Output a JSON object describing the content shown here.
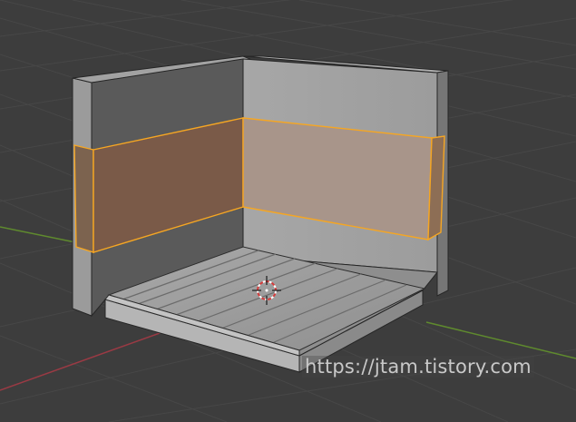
{
  "viewport": {
    "background_color": "#3d3d3d",
    "grid_color": "#474747",
    "x_axis_color": "#9a3a44",
    "y_axis_color": "#5f8a2e",
    "selection_color": "#f5a623",
    "selected_face_tint": "#c9865a"
  },
  "watermark": {
    "text": "https://jtam.tistory.com"
  },
  "objects": {
    "room_walls": "room-walls",
    "wooden_floor": "wooden-floor",
    "selected_band": "selected-face-band",
    "cursor": "3d-cursor-icon"
  }
}
